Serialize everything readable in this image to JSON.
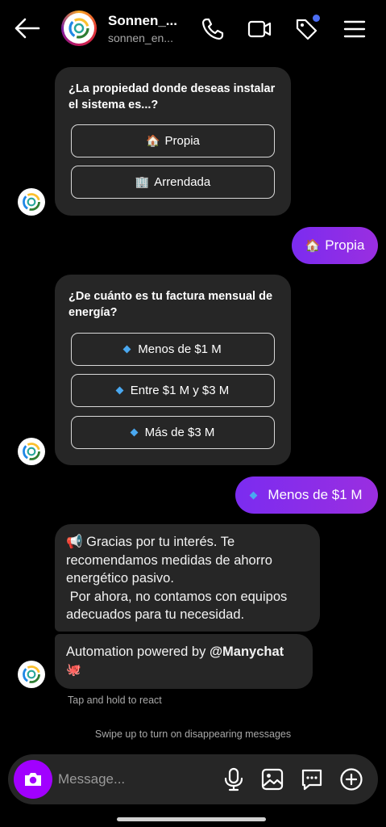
{
  "header": {
    "name": "Sonnen_...",
    "username": "sonnen_en..."
  },
  "card1": {
    "question": "¿La propiedad donde deseas instalar el sistema es...?",
    "options": [
      {
        "icon": "🏠",
        "label": "Propia"
      },
      {
        "icon": "🏢",
        "label": "Arrendada"
      }
    ]
  },
  "reply1": {
    "icon": "🏠",
    "text": "Propia"
  },
  "card2": {
    "question": "¿De cuánto es tu factura mensual de energía?",
    "options": [
      {
        "label": "Menos de $1 M"
      },
      {
        "label": "Entre $1 M y $3 M"
      },
      {
        "label": "Más de $3 M"
      }
    ]
  },
  "reply2": {
    "text": "Menos de $1 M"
  },
  "message1": {
    "emoji": "📢",
    "line1": "Gracias por tu interés. Te",
    "line2": "recomendamos medidas de ahorro",
    "line3": "energético pasivo.",
    "line4": " Por ahora, no contamos con equipos",
    "line5": "adecuados para tu necesidad."
  },
  "message2": {
    "prefix": "Automation powered by ",
    "brand": "@Manychat",
    "emoji": "🐙"
  },
  "hints": {
    "react": "Tap and hold to react",
    "disappearing": "Swipe up to turn on disappearing messages"
  },
  "composer": {
    "placeholder": "Message..."
  },
  "colors": {
    "accent": "#a100ff",
    "user_bubble": "#8a2be2",
    "bubble": "#262626",
    "badge": "#4c6ef5"
  }
}
